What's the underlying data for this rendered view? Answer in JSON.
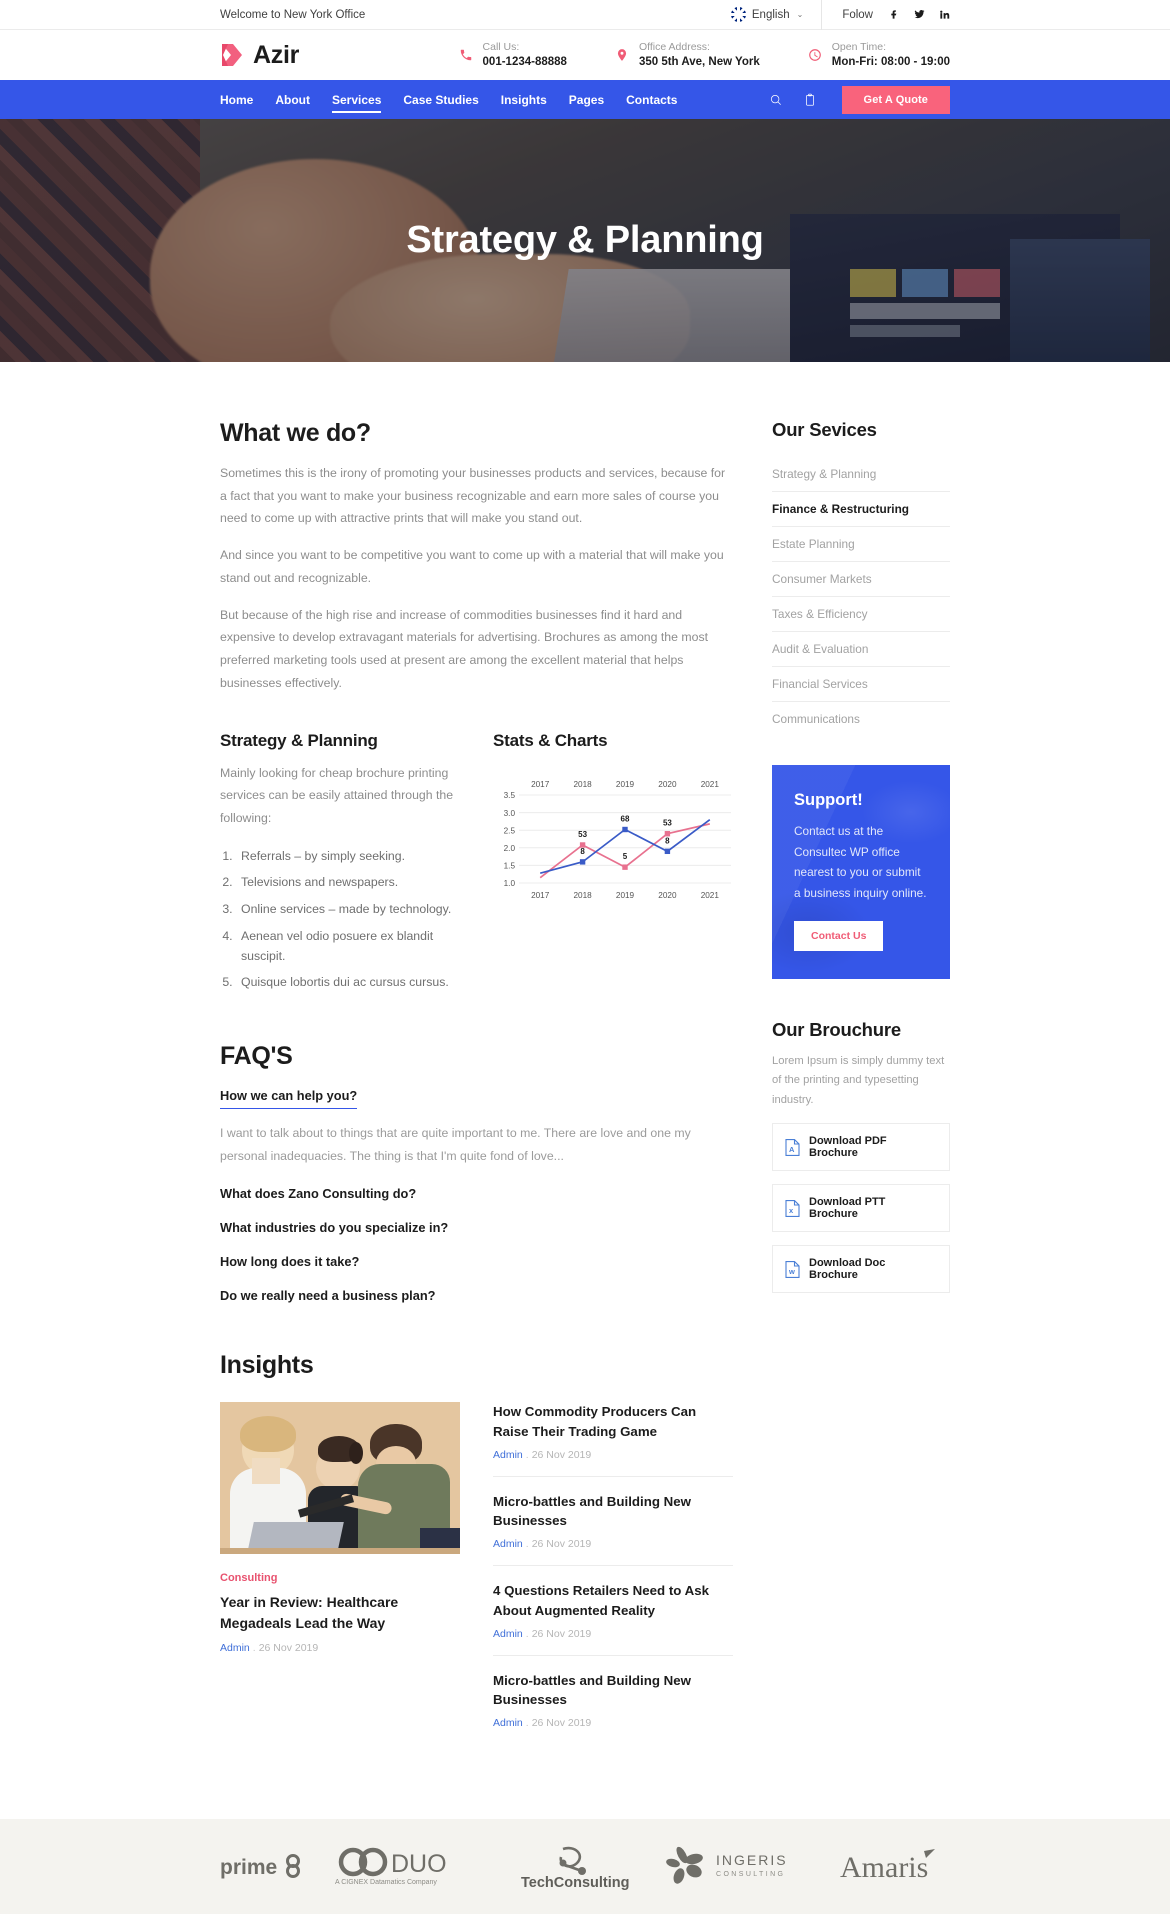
{
  "topbar": {
    "welcome": "Welcome to New York Office",
    "language": "English",
    "language_caret": "⌄",
    "follow_label": "Folow",
    "socials": [
      "facebook-icon",
      "twitter-icon",
      "linkedin-icon"
    ]
  },
  "header": {
    "brand": "Azir",
    "info": [
      {
        "label": "Call Us:",
        "value": "001-1234-88888",
        "icon": "phone-icon"
      },
      {
        "label": "Office Address:",
        "value": "350 5th Ave, New York",
        "icon": "map-pin-icon"
      },
      {
        "label": "Open Time:",
        "value": "Mon-Fri: 08:00 - 19:00",
        "icon": "clock-icon"
      }
    ]
  },
  "nav": {
    "items": [
      {
        "label": "Home",
        "active": false
      },
      {
        "label": "About",
        "active": false
      },
      {
        "label": "Services",
        "active": true
      },
      {
        "label": "Case Studies",
        "active": false
      },
      {
        "label": "Insights",
        "active": false
      },
      {
        "label": "Pages",
        "active": false
      },
      {
        "label": "Contacts",
        "active": false
      }
    ],
    "search_icon": "search-icon",
    "cart_icon": "cart-icon",
    "quote_button": "Get A Quote",
    "accent": "#3556e8",
    "quote_color": "#f9637c"
  },
  "hero": {
    "title": "Strategy & Planning"
  },
  "main": {
    "heading": "What we do?",
    "paragraphs": [
      "Sometimes this is the irony of promoting your businesses products and services, because for a fact that you want to make your business recognizable and earn more sales of course you need to come up with attractive prints that will make you stand out.",
      "And since you want to be competitive you want to come up with a material that will make you stand out and recognizable.",
      "But because of the high rise and increase of commodities businesses find it hard and expensive to develop extravagant materials for advertising. Brochures as among the most preferred marketing tools used at present are among the excellent material that helps businesses effectively."
    ],
    "strategy": {
      "title": "Strategy & Planning",
      "intro": "Mainly looking for cheap brochure printing services can be easily attained through the following:",
      "items": [
        "Referrals – by simply seeking.",
        "Televisions and newspapers.",
        "Online services – made by technology.",
        "Aenean vel odio posuere ex blandit suscipit.",
        "Quisque lobortis dui ac cursus cursus."
      ]
    },
    "stats_title": "Stats & Charts"
  },
  "chart_data": {
    "type": "line",
    "title": "Stats & Charts",
    "x": [
      "2017",
      "2018",
      "2019",
      "2020",
      "2021"
    ],
    "categories": [
      "2017",
      "2018",
      "2019",
      "2020",
      "2021"
    ],
    "top_tick_labels": [
      "2017",
      "2018",
      "2019",
      "2020",
      "2021"
    ],
    "bottom_tick_labels": [
      "2017",
      "2018",
      "2019",
      "2020",
      "2021"
    ],
    "ytick_labels": [
      "1.0",
      "1.5",
      "2.0",
      "2.5",
      "3.0",
      "3.5"
    ],
    "ylim": [
      1.0,
      3.5
    ],
    "grid": true,
    "legend": "none",
    "series": [
      {
        "name": "Series 1",
        "color": "#e8718f",
        "values": [
          1.15,
          2.08,
          1.45,
          2.4,
          2.68
        ],
        "point_labels": [
          "",
          "53",
          "5",
          "53",
          ""
        ]
      },
      {
        "name": "Series 2",
        "color": "#3a5bc7",
        "values": [
          1.28,
          1.6,
          2.52,
          1.9,
          2.8
        ],
        "point_labels": [
          "",
          "8",
          "68",
          "8",
          ""
        ]
      }
    ]
  },
  "faq": {
    "title": "FAQ'S",
    "open_question": "How we can help you?",
    "open_answer": "I want to talk about to things that are quite important to me. There are love and one my personal inadequacies. The thing is that I'm quite fond of love...",
    "questions": [
      "What does Zano Consulting do?",
      "What industries do you specialize in?",
      "How long does it take?",
      "Do we really need a business plan?"
    ]
  },
  "insights": {
    "title": "Insights",
    "featured": {
      "category": "Consulting",
      "title": "Year in Review: Healthcare Megadeals Lead the Way",
      "author": "Admin",
      "date": "26 Nov 2019"
    },
    "list": [
      {
        "title": "How Commodity Producers Can Raise Their Trading Game",
        "author": "Admin",
        "date": "26 Nov 2019"
      },
      {
        "title": "Micro-battles and Building New Businesses",
        "author": "Admin",
        "date": "26 Nov 2019"
      },
      {
        "title": "4 Questions Retailers Need to Ask About Augmented Reality",
        "author": "Admin",
        "date": "26 Nov 2019"
      },
      {
        "title": "Micro-battles and Building New Businesses",
        "author": "Admin",
        "date": "26 Nov 2019"
      }
    ]
  },
  "sidebar": {
    "services_title": "Our Sevices",
    "services": [
      {
        "label": "Strategy & Planning",
        "active": false
      },
      {
        "label": "Finance & Restructuring",
        "active": true
      },
      {
        "label": "Estate Planning",
        "active": false
      },
      {
        "label": "Consumer Markets",
        "active": false
      },
      {
        "label": "Taxes & Efficiency",
        "active": false
      },
      {
        "label": "Audit & Evaluation",
        "active": false
      },
      {
        "label": "Financial Services",
        "active": false
      },
      {
        "label": "Communications",
        "active": false
      }
    ],
    "support": {
      "title": "Support!",
      "text": "Contact us at the Consultec WP office nearest to you or submit a business inquiry online.",
      "button": "Contact Us"
    },
    "brouchure": {
      "title": "Our Brouchure",
      "text": "Lorem Ipsum is simply dummy text of the printing and typesetting industry.",
      "downloads": [
        {
          "label": "Download PDF Brochure",
          "icon": "pdf-file-icon"
        },
        {
          "label": "Download PTT Brochure",
          "icon": "excel-file-icon"
        },
        {
          "label": "Download Doc Brochure",
          "icon": "word-file-icon"
        }
      ]
    }
  },
  "logos": [
    {
      "name": "prime",
      "text": "prime"
    },
    {
      "name": "duo",
      "text": "DUO",
      "sub": "A CIGNEX Datamatics Company"
    },
    {
      "name": "techconsulting",
      "text": "TechConsulting"
    },
    {
      "name": "ingeris",
      "text": "INGERIS",
      "sub": "CONSULTING"
    },
    {
      "name": "amaris",
      "text": "Amaris"
    }
  ]
}
